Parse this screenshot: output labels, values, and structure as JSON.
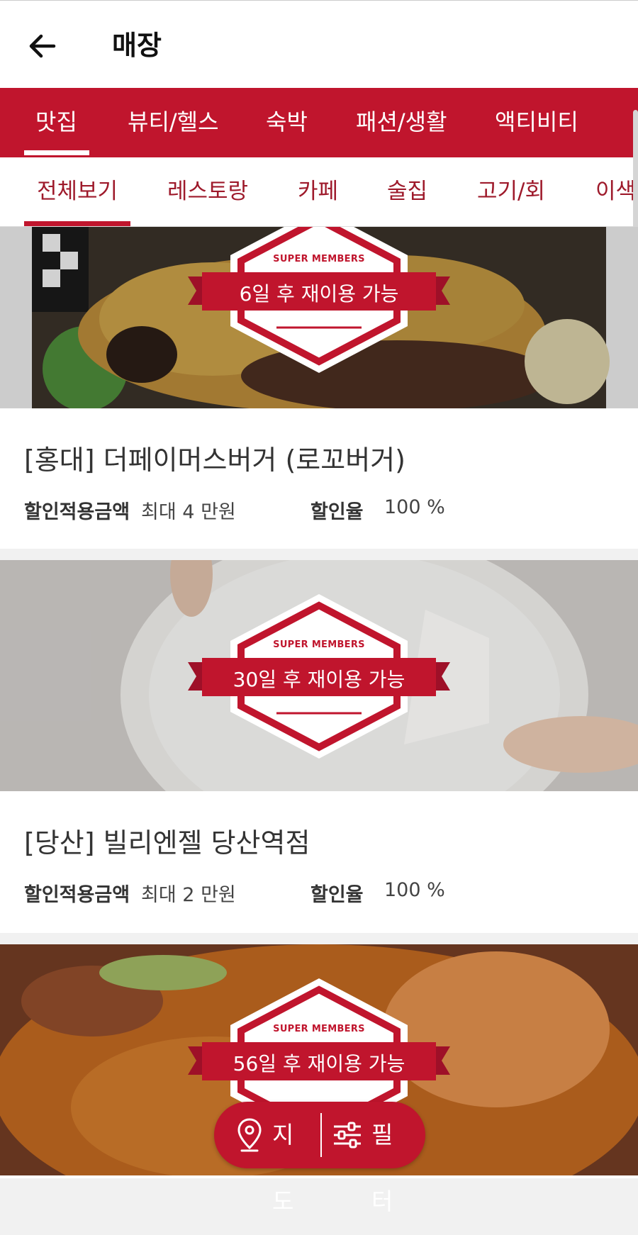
{
  "header": {
    "title": "매장",
    "back_icon": "arrow-left-icon"
  },
  "categories": [
    "맛집",
    "뷰티/헬스",
    "숙박",
    "패션/생활",
    "액티비티"
  ],
  "subcategories": [
    "전체보기",
    "레스토랑",
    "카페",
    "술집",
    "고기/회",
    "이색"
  ],
  "colors": {
    "brand": "#c0152d",
    "text": "#333333"
  },
  "labels": {
    "discount_amount": "할인적용금액",
    "discount_rate": "할인율"
  },
  "stores": [
    {
      "badge_brand": "SUPER MEMBERS",
      "reuse": "6일 후 재이용 가능",
      "name": "[홍대] 더페이머스버거 (로꼬버거)",
      "max_amount": "최대 4 만원",
      "rate": "100 %"
    },
    {
      "badge_brand": "SUPER MEMBERS",
      "reuse": "30일 후 재이용 가능",
      "name": "[당산] 빌리엔젤 당산역점",
      "max_amount": "최대 2 만원",
      "rate": "100 %"
    },
    {
      "badge_brand": "SUPER MEMBERS",
      "reuse": "56일 후 재이용 가능"
    }
  ],
  "fab": {
    "map_label": "지도",
    "filter_label": "필터",
    "map_icon": "location-pin-icon",
    "filter_icon": "sliders-icon"
  }
}
